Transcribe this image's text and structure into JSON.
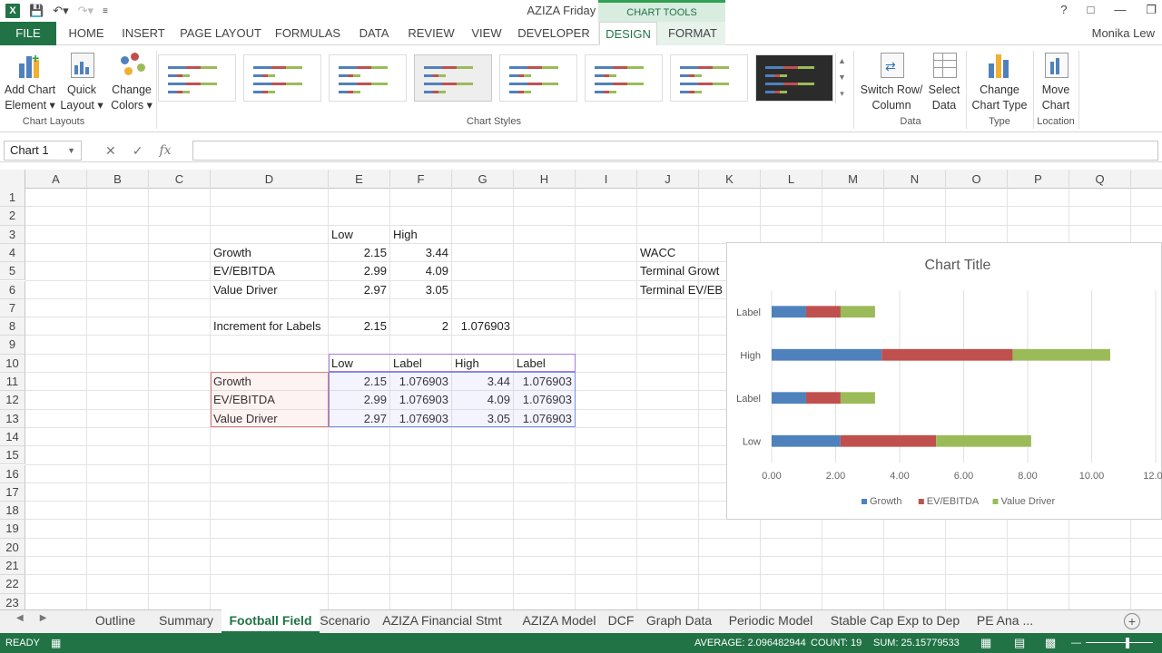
{
  "window": {
    "title": "AZIZA Friday - Excel",
    "user": "Monika Lew",
    "help": "?",
    "contextual_group": "CHART TOOLS"
  },
  "tabs": [
    "FILE",
    "HOME",
    "INSERT",
    "PAGE LAYOUT",
    "FORMULAS",
    "DATA",
    "REVIEW",
    "VIEW",
    "DEVELOPER",
    "DESIGN",
    "FORMAT"
  ],
  "active_tab": "DESIGN",
  "ribbon": {
    "add_chart_element": [
      "Add Chart",
      "Element"
    ],
    "quick_layout": [
      "Quick",
      "Layout"
    ],
    "change_colors": [
      "Change",
      "Colors"
    ],
    "switch_row_column": [
      "Switch Row/",
      "Column"
    ],
    "select_data": [
      "Select",
      "Data"
    ],
    "change_chart_type": [
      "Change",
      "Chart Type"
    ],
    "move_chart": [
      "Move",
      "Chart"
    ],
    "groups": {
      "chart_layouts": "Chart Layouts",
      "chart_styles": "Chart Styles",
      "data": "Data",
      "type": "Type",
      "location": "Location"
    }
  },
  "formula_bar": {
    "name_box": "Chart 1",
    "fx": "fx",
    "value": ""
  },
  "columns": [
    "A",
    "B",
    "C",
    "D",
    "E",
    "F",
    "G",
    "H",
    "I",
    "J",
    "K",
    "L",
    "M",
    "N",
    "O",
    "P",
    "Q"
  ],
  "rows": [
    "1",
    "2",
    "3",
    "4",
    "5",
    "6",
    "7",
    "8",
    "9",
    "10",
    "11",
    "12",
    "13",
    "14",
    "15",
    "16",
    "17",
    "18",
    "19",
    "20",
    "21",
    "22",
    "23"
  ],
  "cells": {
    "E3": "Low",
    "F3": "High",
    "D4": "Growth",
    "E4": "2.15",
    "F4": "3.44",
    "D5": "EV/EBITDA",
    "E5": "2.99",
    "F5": "4.09",
    "D6": "Value Driver",
    "E6": "2.97",
    "F6": "3.05",
    "D8": "Increment for Labels",
    "E8": "2.15",
    "F8": "2",
    "G8": "1.076903",
    "E10": "Low",
    "F10": "Label",
    "G10": "High",
    "H10": "Label",
    "D11": "Growth",
    "E11": "2.15",
    "F11": "1.076903",
    "G11": "3.44",
    "H11": "1.076903",
    "D12": "EV/EBITDA",
    "E12": "2.99",
    "F12": "1.076903",
    "G12": "4.09",
    "H12": "1.076903",
    "D13": "Value Driver",
    "E13": "2.97",
    "F13": "1.076903",
    "G13": "3.05",
    "H13": "1.076903",
    "J4": "WACC",
    "J5": "Terminal Growt",
    "J6": "Terminal EV/EB"
  },
  "chart_data": {
    "type": "bar",
    "orientation": "horizontal",
    "stacked": true,
    "title": "Chart Title",
    "categories": [
      "Low",
      "Label",
      "High",
      "Label"
    ],
    "series": [
      {
        "name": "Growth",
        "color": "#4f81bd",
        "values": [
          2.15,
          1.076903,
          3.44,
          1.076903
        ]
      },
      {
        "name": "EV/EBITDA",
        "color": "#c0504d",
        "values": [
          2.99,
          1.076903,
          4.09,
          1.076903
        ]
      },
      {
        "name": "Value Driver",
        "color": "#9bbb59",
        "values": [
          2.97,
          1.076903,
          3.05,
          1.076903
        ]
      }
    ],
    "xlim": [
      0,
      12
    ],
    "xticks": [
      "0.00",
      "2.00",
      "4.00",
      "6.00",
      "8.00",
      "10.00",
      "12.00"
    ],
    "legend_position": "bottom",
    "grid": true
  },
  "sheet_tabs": [
    "Outline",
    "Summary",
    "Football Field",
    "Scenario",
    "AZIZA Financial Stmt",
    "AZIZA Model",
    "DCF",
    "Graph Data",
    "Periodic Model",
    "Stable Cap Exp to Dep",
    "PE Ana ..."
  ],
  "active_sheet": "Football Field",
  "status": {
    "mode": "READY",
    "average": "AVERAGE: 2.096482944",
    "count": "COUNT: 19",
    "sum": "SUM: 25.15779533"
  }
}
